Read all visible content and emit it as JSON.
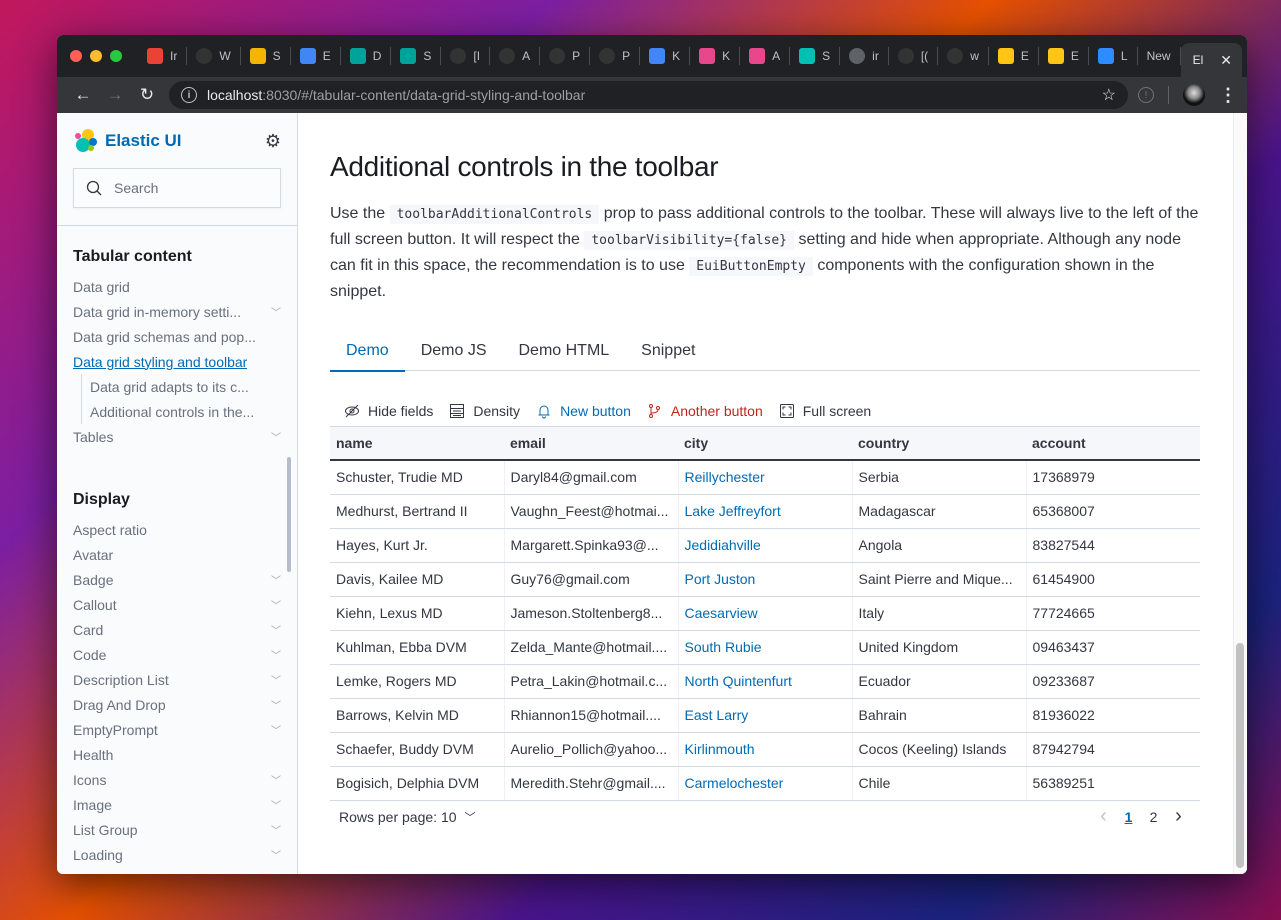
{
  "browser": {
    "tabs": [
      {
        "letter": "Ir",
        "favicon": "gmail-icon",
        "color": "#ea4335"
      },
      {
        "letter": "W",
        "favicon": "github-failed-icon",
        "color": "#333"
      },
      {
        "letter": "S",
        "favicon": "slides-icon",
        "color": "#f4b400"
      },
      {
        "letter": "E",
        "favicon": "calendar-icon",
        "color": "#4285f4"
      },
      {
        "letter": "D",
        "favicon": "diamond-icon",
        "color": "#00a39a"
      },
      {
        "letter": "S",
        "favicon": "sketch-diamond-icon",
        "color": "#00a39a"
      },
      {
        "letter": "[I",
        "favicon": "github-failed-icon",
        "color": "#333"
      },
      {
        "letter": "A",
        "favicon": "github-success-icon",
        "color": "#333"
      },
      {
        "letter": "P",
        "favicon": "github-icon",
        "color": "#333"
      },
      {
        "letter": "P",
        "favicon": "github-icon",
        "color": "#333"
      },
      {
        "letter": "K",
        "favicon": "docs-icon",
        "color": "#4285f4"
      },
      {
        "letter": "K",
        "favicon": "kibana-icon",
        "color": "#e8478b"
      },
      {
        "letter": "A",
        "favicon": "kibana-logo-icon",
        "color": "#e8478b"
      },
      {
        "letter": "S",
        "favicon": "diamond-icon",
        "color": "#00bfb3"
      },
      {
        "letter": "ir",
        "favicon": "globe-icon",
        "color": "#5f6368"
      },
      {
        "letter": "[(",
        "favicon": "github-icon",
        "color": "#333"
      },
      {
        "letter": "w",
        "favicon": "github-icon",
        "color": "#333"
      },
      {
        "letter": "E",
        "favicon": "elastic-icon",
        "color": "#fec514"
      },
      {
        "letter": "E",
        "favicon": "elastic-icon",
        "color": "#fec514"
      },
      {
        "letter": "L",
        "favicon": "zoom-icon",
        "color": "#2d8cff"
      },
      {
        "letter": "New",
        "favicon": "",
        "color": ""
      }
    ],
    "active_tab": {
      "letter": "El"
    },
    "url_host": "localhost",
    "url_rest": ":8030/#/tabular-content/data-grid-styling-and-toolbar"
  },
  "sidebar": {
    "brand": "Elastic UI",
    "search_placeholder": "Search",
    "sections": [
      {
        "title": "Tabular content",
        "items": [
          {
            "label": "Data grid",
            "chevron": false
          },
          {
            "label": "Data grid in-memory setti...",
            "chevron": true
          },
          {
            "label": "Data grid schemas and pop...",
            "chevron": false
          },
          {
            "label": "Data grid styling and toolbar",
            "chevron": false,
            "selected": true
          },
          {
            "label": "Data grid adapts to its c...",
            "sub": true
          },
          {
            "label": "Additional controls in the...",
            "sub": true
          },
          {
            "label": "Tables",
            "chevron": true
          }
        ]
      },
      {
        "title": "Display",
        "items": [
          {
            "label": "Aspect ratio",
            "chevron": false
          },
          {
            "label": "Avatar",
            "chevron": false
          },
          {
            "label": "Badge",
            "chevron": true
          },
          {
            "label": "Callout",
            "chevron": true
          },
          {
            "label": "Card",
            "chevron": true
          },
          {
            "label": "Code",
            "chevron": true
          },
          {
            "label": "Description List",
            "chevron": true
          },
          {
            "label": "Drag And Drop",
            "chevron": true
          },
          {
            "label": "EmptyPrompt",
            "chevron": true
          },
          {
            "label": "Health",
            "chevron": false
          },
          {
            "label": "Icons",
            "chevron": true
          },
          {
            "label": "Image",
            "chevron": true
          },
          {
            "label": "List Group",
            "chevron": true
          },
          {
            "label": "Loading",
            "chevron": true
          }
        ]
      }
    ]
  },
  "main": {
    "title": "Additional controls in the toolbar",
    "desc": {
      "p1": "Use the ",
      "code1": "toolbarAdditionalControls",
      "p2": " prop to pass additional controls to the toolbar. These will always live to the left of the full screen button. It will respect the ",
      "code2": "toolbarVisibility={false}",
      "p3": " setting and hide when appropriate. Although any node can fit in this space, the recommendation is to use ",
      "code3": "EuiButtonEmpty",
      "p4": " components with the configuration shown in the snippet."
    },
    "tabs": [
      {
        "label": "Demo",
        "active": true
      },
      {
        "label": "Demo JS"
      },
      {
        "label": "Demo HTML"
      },
      {
        "label": "Snippet"
      }
    ],
    "grid": {
      "toolbar": {
        "hide_fields": "Hide fields",
        "density": "Density",
        "new_button": "New button",
        "another_button": "Another button",
        "full_screen": "Full screen"
      },
      "columns": [
        "name",
        "email",
        "city",
        "country",
        "account"
      ],
      "rows": [
        [
          "Schuster, Trudie MD",
          "Daryl84@gmail.com",
          "Reillychester",
          "Serbia",
          "17368979"
        ],
        [
          "Medhurst, Bertrand II",
          "Vaughn_Feest@hotmai...",
          "Lake Jeffreyfort",
          "Madagascar",
          "65368007"
        ],
        [
          "Hayes, Kurt Jr.",
          "Margarett.Spinka93@...",
          "Jedidiahville",
          "Angola",
          "83827544"
        ],
        [
          "Davis, Kailee MD",
          "Guy76@gmail.com",
          "Port Juston",
          "Saint Pierre and Mique...",
          "61454900"
        ],
        [
          "Kiehn, Lexus MD",
          "Jameson.Stoltenberg8...",
          "Caesarview",
          "Italy",
          "77724665"
        ],
        [
          "Kuhlman, Ebba DVM",
          "Zelda_Mante@hotmail....",
          "South Rubie",
          "United Kingdom",
          "09463437"
        ],
        [
          "Lemke, Rogers MD",
          "Petra_Lakin@hotmail.c...",
          "North Quintenfurt",
          "Ecuador",
          "09233687"
        ],
        [
          "Barrows, Kelvin MD",
          "Rhiannon15@hotmail....",
          "East Larry",
          "Bahrain",
          "81936022"
        ],
        [
          "Schaefer, Buddy DVM",
          "Aurelio_Pollich@yahoo...",
          "Kirlinmouth",
          "Cocos (Keeling) Islands",
          "87942794"
        ],
        [
          "Bogisich, Delphia DVM",
          "Meredith.Stehr@gmail....",
          "Carmelochester",
          "Chile",
          "56389251"
        ]
      ],
      "rows_per_page": "Rows per page: 10",
      "pages": [
        "1",
        "2"
      ],
      "current_page": "1"
    }
  },
  "colors": {
    "accent": "#006bb4",
    "danger": "#bd271e",
    "text": "#343741"
  }
}
